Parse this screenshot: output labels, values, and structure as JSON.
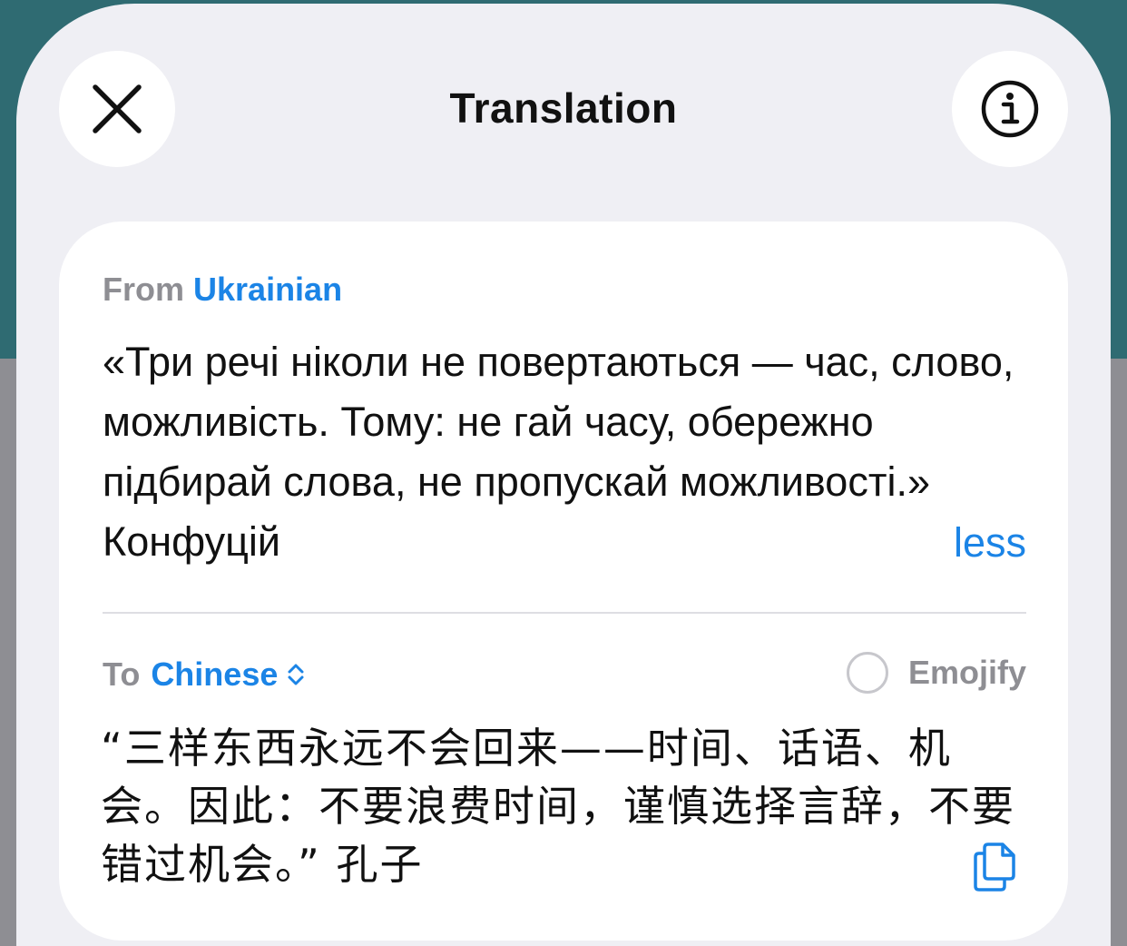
{
  "header": {
    "title": "Translation",
    "close_icon": "close-icon",
    "info_icon": "info-icon"
  },
  "source": {
    "label": "From",
    "language": "Ukrainian",
    "text": "«Три речі ніколи не повертаються — час, слово, можливість. Тому: не гай часу, обережно підбирай слова, не пропускай можливості.» Конфуцій",
    "less_label": "less"
  },
  "target": {
    "label": "To",
    "language": "Chinese",
    "language_picker_icon": "chevron-up-down-icon",
    "emojify_label": "Emojify",
    "emojify_checked": false,
    "text": "“三样东西永远不会回来——时间、话语、机会。因此：不要浪费时间，谨慎选择言辞，不要错过机会。” 孔子",
    "copy_icon": "copy-icon"
  },
  "colors": {
    "accent": "#1b84e6",
    "secondary_text": "#8e8e93",
    "sheet_background": "#efeff4",
    "card_background": "#ffffff",
    "backdrop_top": "#2f6b72",
    "backdrop_bottom": "#8e8e93"
  }
}
